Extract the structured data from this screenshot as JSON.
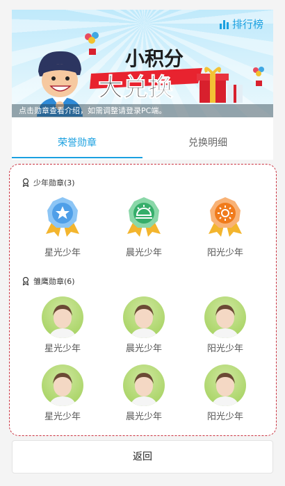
{
  "banner": {
    "title_line1": "小积分",
    "title_line2": "大兑换",
    "caption": "点击勋章查看介绍，如需调整请登录PC端。",
    "rank_label": "排行榜"
  },
  "tabs": [
    {
      "label": "荣誉勋章",
      "active": true
    },
    {
      "label": "兑换明细",
      "active": false
    }
  ],
  "sections": [
    {
      "title": "少年勋章(3)",
      "badges": [
        {
          "name": "星光少年",
          "icon": "star-medal-icon",
          "color": "#4f9fe8"
        },
        {
          "name": "晨光少年",
          "icon": "sunrise-medal-icon",
          "color": "#35ae6a"
        },
        {
          "name": "阳光少年",
          "icon": "sun-medal-icon",
          "color": "#f07b1c"
        }
      ]
    },
    {
      "title": "雏鹰勋章(6)",
      "badges": [
        {
          "name": "星光少年",
          "icon": "student-photo"
        },
        {
          "name": "晨光少年",
          "icon": "student-photo"
        },
        {
          "name": "阳光少年",
          "icon": "student-photo"
        },
        {
          "name": "星光少年",
          "icon": "student-photo"
        },
        {
          "name": "晨光少年",
          "icon": "student-photo"
        },
        {
          "name": "阳光少年",
          "icon": "student-photo"
        }
      ]
    }
  ],
  "back_label": "返回",
  "colors": {
    "accent": "#1aa0e0",
    "border_dashed": "#c9303e",
    "ribbon": "#f3b52e"
  }
}
